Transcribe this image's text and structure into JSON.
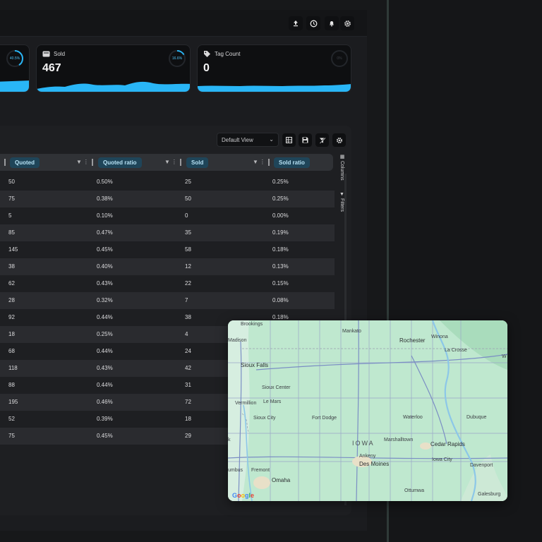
{
  "topbar": {
    "icons": [
      "upload-icon",
      "clock-icon",
      "bell-icon",
      "gear-icon"
    ]
  },
  "cards": [
    {
      "label": "",
      "value": "",
      "ring": "40.5%",
      "ring_fraction": 0.405,
      "icon": "chart-icon"
    },
    {
      "label": "Sold",
      "value": "467",
      "ring": "16.6%",
      "ring_fraction": 0.166,
      "icon": "tag-box-icon"
    },
    {
      "label": "Tag Count",
      "value": "0",
      "ring": "0%",
      "ring_fraction": 0,
      "icon": "tag-icon"
    }
  ],
  "toolbar": {
    "view_label": "Default View",
    "icons": [
      "table-icon",
      "save-icon",
      "clear-filter-icon",
      "gear-icon"
    ]
  },
  "table": {
    "columns": [
      "Quoted",
      "Quoted ratio",
      "Sold",
      "Sold ratio"
    ],
    "rows": [
      [
        "50",
        "0.50%",
        "25",
        "0.25%"
      ],
      [
        "75",
        "0.38%",
        "50",
        "0.25%"
      ],
      [
        "5",
        "0.10%",
        "0",
        "0.00%"
      ],
      [
        "85",
        "0.47%",
        "35",
        "0.19%"
      ],
      [
        "145",
        "0.45%",
        "58",
        "0.18%"
      ],
      [
        "38",
        "0.40%",
        "12",
        "0.13%"
      ],
      [
        "62",
        "0.43%",
        "22",
        "0.15%"
      ],
      [
        "28",
        "0.32%",
        "7",
        "0.08%"
      ],
      [
        "92",
        "0.44%",
        "38",
        "0.18%"
      ],
      [
        "18",
        "0.25%",
        "4",
        ""
      ],
      [
        "68",
        "0.44%",
        "24",
        ""
      ],
      [
        "118",
        "0.43%",
        "42",
        ""
      ],
      [
        "88",
        "0.44%",
        "31",
        ""
      ],
      [
        "195",
        "0.46%",
        "72",
        ""
      ],
      [
        "52",
        "0.39%",
        "18",
        ""
      ],
      [
        "75",
        "0.45%",
        "29",
        ""
      ]
    ]
  },
  "side_tabs": {
    "columns": "Columns",
    "filters": "Filters"
  },
  "map": {
    "places": {
      "brookings": "Brookings",
      "mankato": "Mankato",
      "madison": "Madison",
      "rochester": "Rochester",
      "winona": "Winona",
      "la_crosse": "La Crosse",
      "sioux_falls": "Sioux Falls",
      "sioux_center": "Sioux Center",
      "vermillion": "Vermillion",
      "le_mars": "Le Mars",
      "sioux_city": "Sioux City",
      "fort_dodge": "Fort Dodge",
      "waterloo": "Waterloo",
      "dubuque": "Dubuque",
      "iowa": "IOWA",
      "marshalltown": "Marshalltown",
      "cedar_rapids": "Cedar Rapids",
      "ankeny": "Ankeny",
      "des_moines": "Des Moines",
      "iowa_city": "Iowa City",
      "davenport": "Davenport",
      "columbus": "umbus",
      "fremont": "Fremont",
      "omaha": "Omaha",
      "ottumwa": "Ottumwa",
      "galesburg": "Galesburg",
      "edge_k": "k",
      "edge_w": "W"
    },
    "google_logo": "Google"
  },
  "colors": {
    "accent": "#29b6f6",
    "header_pill": "#1f4559",
    "map_land": "#bfe8cf"
  }
}
